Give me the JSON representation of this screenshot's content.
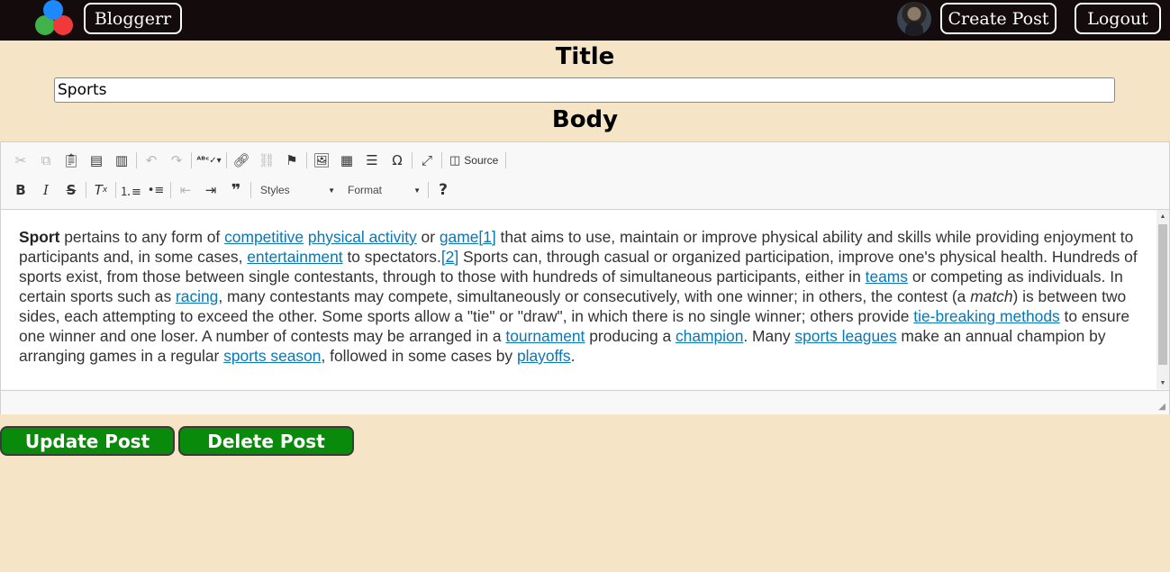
{
  "navbar": {
    "brand_label": "Bloggerr",
    "create_label": "Create Post",
    "logout_label": "Logout",
    "logo_icon": "three-circles-logo",
    "avatar_icon": "user-avatar"
  },
  "form": {
    "title_heading": "Title",
    "title_value": "Sports",
    "body_heading": "Body"
  },
  "toolbar": {
    "source_label": "Source",
    "styles_label": "Styles",
    "format_label": "Format",
    "icons": [
      "cut-icon",
      "copy-icon",
      "paste-icon",
      "paste-text-icon",
      "paste-word-icon",
      "undo-icon",
      "redo-icon",
      "spellcheck-icon",
      "link-icon",
      "unlink-icon",
      "anchor-icon",
      "image-icon",
      "table-icon",
      "horizontal-rule-icon",
      "special-char-icon",
      "maximize-icon",
      "source-icon",
      "bold-icon",
      "italic-icon",
      "strikethrough-icon",
      "remove-format-icon",
      "numbered-list-icon",
      "bulleted-list-icon",
      "outdent-icon",
      "indent-icon",
      "blockquote-icon",
      "help-icon"
    ]
  },
  "content": {
    "s1_bold": "Sport",
    "s2": " pertains to any form of ",
    "l1": "competitive",
    "s3": " ",
    "l2": "physical activity",
    "s4": " or ",
    "l3": "game[1]",
    "s5": " that aims to use, maintain or improve physical ability and skills while providing enjoyment to participants and, in some cases, ",
    "l4": "entertainment",
    "s6": " to spectators.",
    "l5": "[2]",
    "s7": " Sports can, through casual or organized participation, improve one's physical health. Hundreds of sports exist, from those between single contestants, through to those with hundreds of simultaneous participants, either in ",
    "l6": "teams",
    "s8": " or competing as individuals. In certain sports such as ",
    "l7": "racing",
    "s9": ", many contestants may compete, simultaneously or consecutively, with one winner; in others, the contest (a ",
    "s10_italic": "match",
    "s11": ") is between two sides, each attempting to exceed the other. Some sports allow a \"tie\" or \"draw\", in which there is no single winner; others provide ",
    "l8": "tie-breaking methods",
    "s12": " to ensure one winner and one loser. A number of contests may be arranged in a ",
    "l9": "tournament",
    "s13": " producing a ",
    "l10": "champion",
    "s14": ". Many ",
    "l11": "sports leagues",
    "s15": " make an annual champion by arranging games in a regular ",
    "l12": "sports season",
    "s16": ", followed in some cases by ",
    "l13": "playoffs",
    "s17": "."
  },
  "actions": {
    "update_label": "Update Post",
    "delete_label": "Delete Post"
  },
  "colors": {
    "navbar_bg": "#140c0c",
    "page_bg": "#f5e4c6",
    "button_green": "#0a8a0a",
    "link_blue": "#0a77b5"
  }
}
